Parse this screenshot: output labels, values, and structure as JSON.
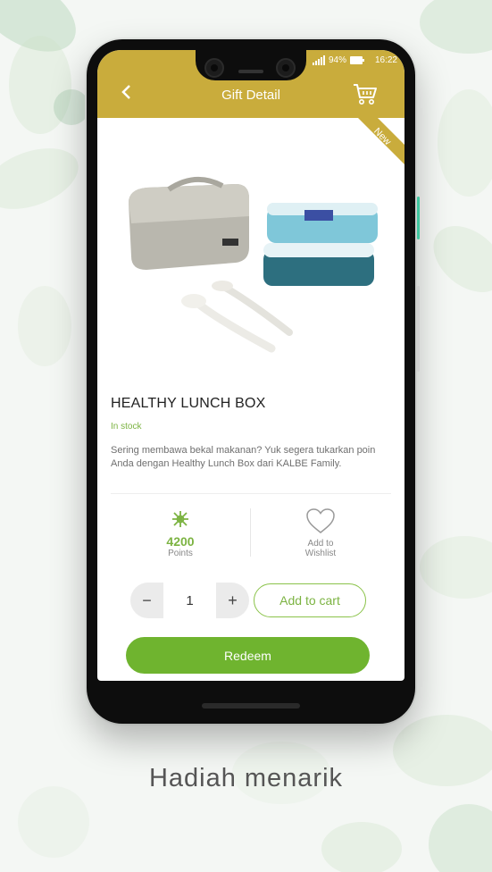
{
  "colors": {
    "header": "#c9ac3c",
    "accent": "#7cb342",
    "button": "#6fb42f"
  },
  "status": {
    "signal": "signal-icon",
    "battery_percent": "94%",
    "battery_icon": "battery-icon",
    "time": "16:22"
  },
  "header": {
    "title": "Gift Detail",
    "back_icon": "chevron-left-icon",
    "cart_icon": "cart-icon"
  },
  "badge": {
    "label": "New"
  },
  "product": {
    "name": "HEALTHY LUNCH BOX",
    "stock": "In stock",
    "description": "Sering membawa bekal makanan? Yuk segera tukarkan poin Anda dengan Healthy Lunch Box dari KALBE Family."
  },
  "points": {
    "icon": "points-icon",
    "value": "4200",
    "label": "Points"
  },
  "wishlist": {
    "icon": "heart-icon",
    "label_line1": "Add to",
    "label_line2": "Wishlist"
  },
  "quantity": {
    "minus": "−",
    "value": "1",
    "plus": "+"
  },
  "actions": {
    "add_to_cart": "Add to cart",
    "redeem": "Redeem"
  },
  "caption": "Hadiah menarik"
}
